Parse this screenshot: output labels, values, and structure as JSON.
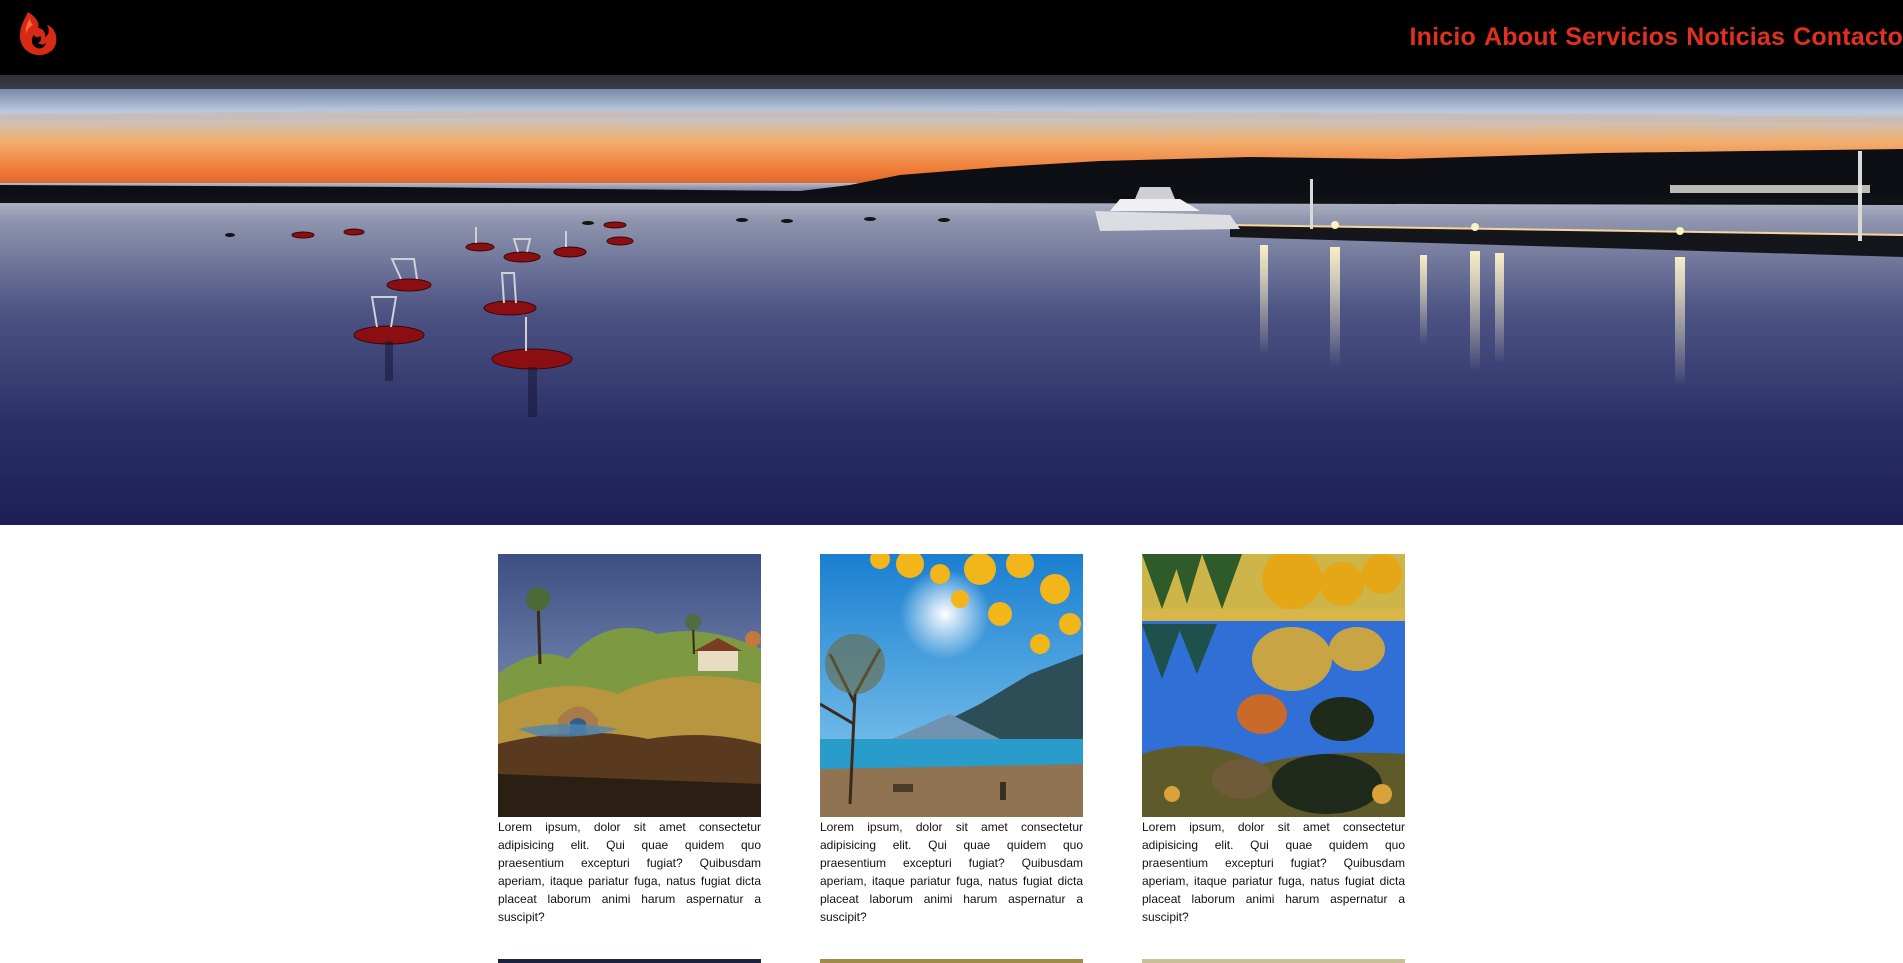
{
  "header": {
    "logo_icon": "flame-logo-icon",
    "accent_color": "#e0301e",
    "nav": [
      {
        "label": "Inicio"
      },
      {
        "label": "About"
      },
      {
        "label": "Servicios"
      },
      {
        "label": "Noticias"
      },
      {
        "label": "Contacto"
      }
    ]
  },
  "hero": {
    "image": "harbor-sunset-banner"
  },
  "cards": [
    {
      "image": "surreal-landscape-painting",
      "text": "Lorem ipsum, dolor sit amet consectetur adipisicing elit. Qui quae quidem quo praesentium excepturi fugiat? Quibusdam aperiam, itaque pariatur fuga, natus fugiat dicta placeat laborum animi harum aspernatur a suscipit?"
    },
    {
      "image": "autumn-lake-mountains",
      "text": "Lorem ipsum, dolor sit amet consectetur adipisicing elit. Qui quae quidem quo praesentium excepturi fugiat? Quibusdam aperiam, itaque pariatur fuga, natus fugiat dicta placeat laborum animi harum aspernatur a suscipit?"
    },
    {
      "image": "autumn-lake-reflection",
      "text": "Lorem ipsum, dolor sit amet consectetur adipisicing elit. Qui quae quidem quo praesentium excepturi fugiat? Quibusdam aperiam, itaque pariatur fuga, natus fugiat dicta placeat laborum animi harum aspernatur a suscipit?"
    }
  ]
}
